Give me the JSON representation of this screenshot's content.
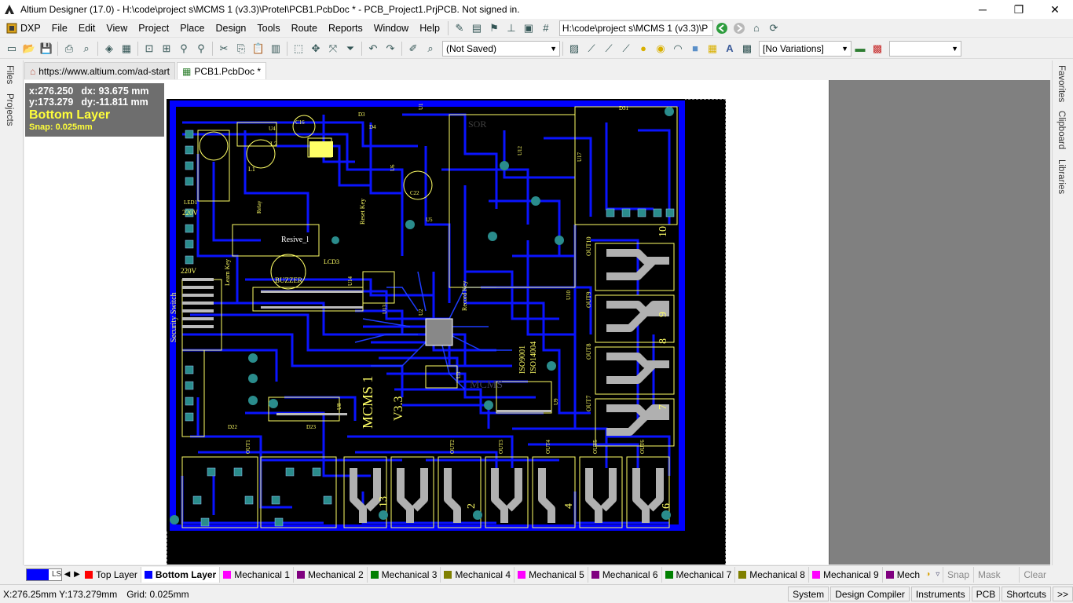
{
  "window": {
    "title": "Altium Designer (17.0) - H:\\code\\project s\\MCMS 1 (v3.3)\\Protel\\PCB1.PcbDoc * - PCB_Project1.PrjPCB. Not signed in.",
    "minimize": "─",
    "maximize": "❐",
    "close": "✕"
  },
  "menu": {
    "dxp": "DXP",
    "items": [
      "File",
      "Edit",
      "View",
      "Project",
      "Place",
      "Design",
      "Tools",
      "Route",
      "Reports",
      "Window",
      "Help"
    ],
    "path": "H:\\code\\project s\\MCMS 1 (v3.3)\\P"
  },
  "toolbar": {
    "saved_state": "(Not Saved)",
    "variations": "[No Variations]",
    "last_dropdown": ""
  },
  "side_panels": {
    "left": [
      "Files",
      "Projects"
    ],
    "right": [
      "Favorites",
      "Clipboard",
      "Libraries"
    ]
  },
  "doc_tabs": [
    {
      "label": "https://www.altium.com/ad-start",
      "active": false
    },
    {
      "label": "PCB1.PcbDoc *",
      "active": true
    }
  ],
  "hud": {
    "x": "x:276.250",
    "dx": "dx: 93.675 mm",
    "y": "y:173.279",
    "dy": "dy:-11.811  mm",
    "layer": "Bottom Layer",
    "snap": "Snap: 0.025mm"
  },
  "pcb": {
    "silk_labels": [
      "MCMS 1",
      "V3.3",
      "BUZZER",
      "Security Switch",
      "Resive_l",
      "Record Key",
      "Learn Key",
      "Reset Key",
      "ISO9001",
      "ISO14004",
      "SOR",
      "MCMS",
      "220V",
      "220V",
      "OUT10",
      "OUT9",
      "OUT8",
      "OUT7",
      "OUT1",
      "OUT2",
      "OUT3",
      "OUT4",
      "OUT5",
      "OUT6",
      "10",
      "9",
      "8",
      "7",
      "13",
      "2",
      "4",
      "6",
      "U1",
      "U2",
      "U3",
      "U4",
      "U5",
      "U6",
      "U8",
      "U9",
      "U10",
      "U12",
      "U13",
      "U14",
      "U17",
      "LCD3",
      "LED1",
      "L1",
      "L2",
      "D3",
      "D4",
      "D9",
      "D31",
      "C16",
      "C22",
      "D22",
      "D23",
      "Relay"
    ]
  },
  "layer_tabs": {
    "ls": "LS",
    "items": [
      {
        "label": "Top Layer",
        "color": "#ff0000"
      },
      {
        "label": "Bottom Layer",
        "color": "#0000ff",
        "active": true
      },
      {
        "label": "Mechanical 1",
        "color": "#ff00ff"
      },
      {
        "label": "Mechanical 2",
        "color": "#800080"
      },
      {
        "label": "Mechanical 3",
        "color": "#008000"
      },
      {
        "label": "Mechanical 4",
        "color": "#808000"
      },
      {
        "label": "Mechanical 5",
        "color": "#ff00ff"
      },
      {
        "label": "Mechanical 6",
        "color": "#800080"
      },
      {
        "label": "Mechanical 7",
        "color": "#008000"
      },
      {
        "label": "Mechanical 8",
        "color": "#808000"
      },
      {
        "label": "Mechanical 9",
        "color": "#ff00ff"
      },
      {
        "label": "Mech",
        "color": "#800080"
      }
    ],
    "snap": "Snap",
    "mask_level": "Mask Level",
    "clear": "Clear"
  },
  "status": {
    "coords": "X:276.25mm Y:173.279mm",
    "grid": "Grid: 0.025mm",
    "buttons": [
      "System",
      "Design Compiler",
      "Instruments",
      "PCB",
      "Shortcuts",
      ">>"
    ]
  }
}
